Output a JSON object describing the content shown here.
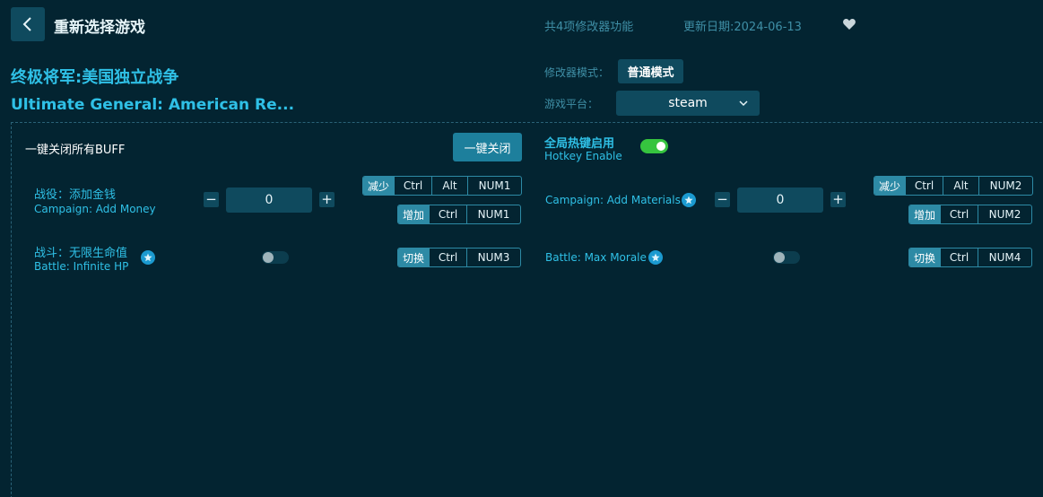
{
  "header": {
    "title": "重新选择游戏",
    "feature_count": "共4项修改器功能",
    "update_date": "更新日期:2024-06-13"
  },
  "game": {
    "name_cn": "终极将军:美国独立战争",
    "name_en": "Ultimate General: American Re..."
  },
  "mode": {
    "label": "修改器模式：",
    "value": "普通模式"
  },
  "platform": {
    "label": "游戏平台：",
    "value": "steam"
  },
  "panel": {
    "buff_label": "一键关闭所有BUFF",
    "close_all": "一键关闭",
    "hotkey_cn": "全局热键启用",
    "hotkey_en": "Hotkey Enable",
    "hotkey_enabled": true
  },
  "features": [
    {
      "name_cn": "战役：添加金钱",
      "name_en": "Campaign: Add Money",
      "value": "0",
      "hotkeys": [
        {
          "tag": "减少",
          "keys": [
            "Ctrl",
            "Alt",
            "NUM1"
          ]
        },
        {
          "tag": "增加",
          "keys": [
            "Ctrl",
            "NUM1"
          ]
        }
      ]
    },
    {
      "name_en": "Campaign: Add Materials",
      "value": "0",
      "hotkeys": [
        {
          "tag": "减少",
          "keys": [
            "Ctrl",
            "Alt",
            "NUM2"
          ]
        },
        {
          "tag": "增加",
          "keys": [
            "Ctrl",
            "NUM2"
          ]
        }
      ]
    },
    {
      "name_cn": "战斗：无限生命值",
      "name_en": "Battle: Infinite HP",
      "enabled": false,
      "hotkeys": [
        {
          "tag": "切换",
          "keys": [
            "Ctrl",
            "NUM3"
          ]
        }
      ]
    },
    {
      "name_en": "Battle: Max Morale",
      "enabled": false,
      "hotkeys": [
        {
          "tag": "切换",
          "keys": [
            "Ctrl",
            "NUM4"
          ]
        }
      ]
    }
  ],
  "icons": {
    "back": "chevron-left-icon",
    "favorite": "heart-icon",
    "dropdown": "chevron-down-icon",
    "premium": "star-icon",
    "minus": "−",
    "plus": "+"
  },
  "colors": {
    "background": "#032431",
    "accent": "#2fc0e6",
    "button": "#0f4a5e",
    "toggle_on": "#36c43f"
  }
}
